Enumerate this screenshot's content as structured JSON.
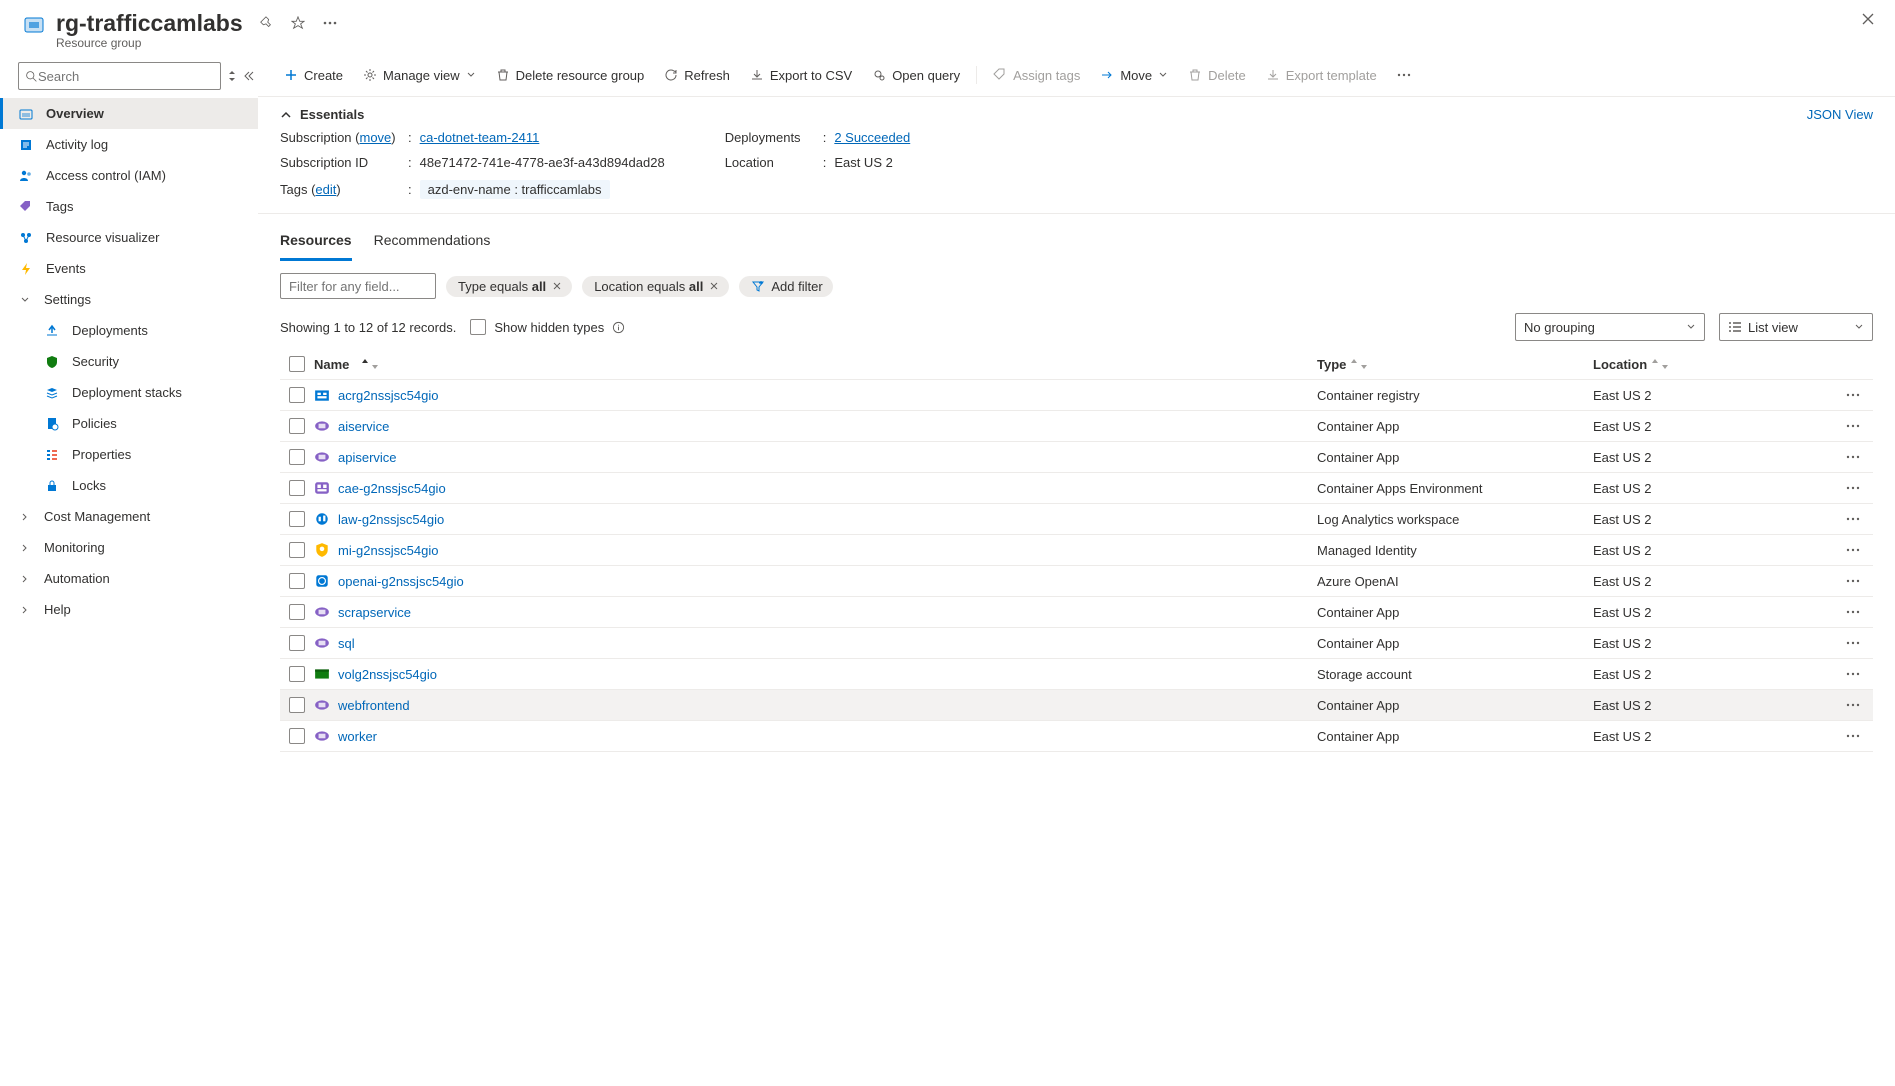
{
  "header": {
    "title": "rg-trafficcamlabs",
    "subtitle": "Resource group"
  },
  "sidebar": {
    "search_placeholder": "Search",
    "items": [
      {
        "label": "Overview"
      },
      {
        "label": "Activity log"
      },
      {
        "label": "Access control (IAM)"
      },
      {
        "label": "Tags"
      },
      {
        "label": "Resource visualizer"
      },
      {
        "label": "Events"
      },
      {
        "label": "Settings"
      },
      {
        "label": "Deployments"
      },
      {
        "label": "Security"
      },
      {
        "label": "Deployment stacks"
      },
      {
        "label": "Policies"
      },
      {
        "label": "Properties"
      },
      {
        "label": "Locks"
      },
      {
        "label": "Cost Management"
      },
      {
        "label": "Monitoring"
      },
      {
        "label": "Automation"
      },
      {
        "label": "Help"
      }
    ]
  },
  "toolbar": {
    "create": "Create",
    "manage_view": "Manage view",
    "delete": "Delete resource group",
    "refresh": "Refresh",
    "export_csv": "Export to CSV",
    "open_query": "Open query",
    "assign_tags": "Assign tags",
    "move": "Move",
    "delete_res": "Delete",
    "export_template": "Export template"
  },
  "essentials": {
    "heading": "Essentials",
    "json_view": "JSON View",
    "subscription_label": "Subscription",
    "subscription_move": "move",
    "subscription_value": "ca-dotnet-team-2411",
    "subscription_id_label": "Subscription ID",
    "subscription_id_value": "48e71472-741e-4778-ae3f-a43d894dad28",
    "tags_label": "Tags",
    "tags_edit": "edit",
    "tag_chip": "azd-env-name : trafficcamlabs",
    "deployments_label": "Deployments",
    "deployments_value": "2 Succeeded",
    "location_label": "Location",
    "location_value": "East US 2"
  },
  "tabs": {
    "resources": "Resources",
    "recommendations": "Recommendations"
  },
  "filters": {
    "placeholder": "Filter for any field...",
    "type_prefix": "Type equals ",
    "type_value": "all",
    "location_prefix": "Location equals ",
    "location_value": "all",
    "add": "Add filter"
  },
  "controls": {
    "showing": "Showing 1 to 12 of 12 records.",
    "hidden": "Show hidden types",
    "grouping": "No grouping",
    "view": "List view"
  },
  "grid": {
    "headers": {
      "name": "Name",
      "type": "Type",
      "location": "Location"
    },
    "rows": [
      {
        "name": "acrg2nssjsc54gio",
        "type": "Container registry",
        "location": "East US 2",
        "icon": "registry"
      },
      {
        "name": "aiservice",
        "type": "Container App",
        "location": "East US 2",
        "icon": "capp"
      },
      {
        "name": "apiservice",
        "type": "Container App",
        "location": "East US 2",
        "icon": "capp"
      },
      {
        "name": "cae-g2nssjsc54gio",
        "type": "Container Apps Environment",
        "location": "East US 2",
        "icon": "caenv"
      },
      {
        "name": "law-g2nssjsc54gio",
        "type": "Log Analytics workspace",
        "location": "East US 2",
        "icon": "law"
      },
      {
        "name": "mi-g2nssjsc54gio",
        "type": "Managed Identity",
        "location": "East US 2",
        "icon": "mi"
      },
      {
        "name": "openai-g2nssjsc54gio",
        "type": "Azure OpenAI",
        "location": "East US 2",
        "icon": "openai"
      },
      {
        "name": "scrapservice",
        "type": "Container App",
        "location": "East US 2",
        "icon": "capp"
      },
      {
        "name": "sql",
        "type": "Container App",
        "location": "East US 2",
        "icon": "capp"
      },
      {
        "name": "volg2nssjsc54gio",
        "type": "Storage account",
        "location": "East US 2",
        "icon": "storage"
      },
      {
        "name": "webfrontend",
        "type": "Container App",
        "location": "East US 2",
        "icon": "capp",
        "hover": true
      },
      {
        "name": "worker",
        "type": "Container App",
        "location": "East US 2",
        "icon": "capp"
      }
    ]
  }
}
